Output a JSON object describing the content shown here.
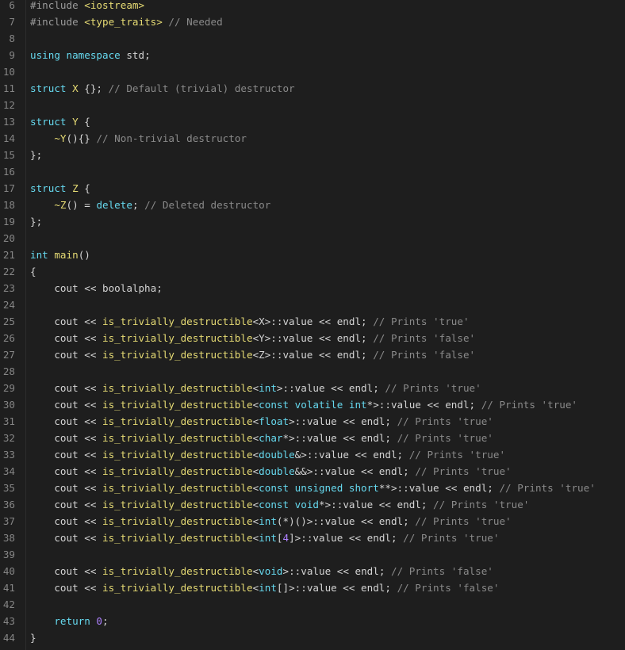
{
  "editor": {
    "lines": [
      {
        "n": "6",
        "tokens": [
          [
            "pp",
            "#include "
          ],
          [
            "inc",
            "<iostream>"
          ]
        ]
      },
      {
        "n": "7",
        "tokens": [
          [
            "pp",
            "#include "
          ],
          [
            "inc",
            "<type_traits>"
          ],
          [
            "cm",
            " // Needed"
          ]
        ]
      },
      {
        "n": "8",
        "tokens": []
      },
      {
        "n": "9",
        "tokens": [
          [
            "kw",
            "using namespace "
          ],
          [
            "tx",
            "std;"
          ]
        ]
      },
      {
        "n": "10",
        "tokens": []
      },
      {
        "n": "11",
        "tokens": [
          [
            "kw",
            "struct "
          ],
          [
            "nm",
            "X"
          ],
          [
            "tx",
            " {}; "
          ],
          [
            "cm",
            "// Default (trivial) destructor"
          ]
        ]
      },
      {
        "n": "12",
        "tokens": []
      },
      {
        "n": "13",
        "tokens": [
          [
            "kw",
            "struct "
          ],
          [
            "nm",
            "Y"
          ],
          [
            "tx",
            " {"
          ]
        ]
      },
      {
        "n": "14",
        "tokens": [
          [
            "tx",
            "    "
          ],
          [
            "fn",
            "~Y"
          ],
          [
            "tx",
            "(){} "
          ],
          [
            "cm",
            "// Non-trivial destructor"
          ]
        ]
      },
      {
        "n": "15",
        "tokens": [
          [
            "tx",
            "};"
          ]
        ]
      },
      {
        "n": "16",
        "tokens": []
      },
      {
        "n": "17",
        "tokens": [
          [
            "kw",
            "struct "
          ],
          [
            "nm",
            "Z"
          ],
          [
            "tx",
            " {"
          ]
        ]
      },
      {
        "n": "18",
        "tokens": [
          [
            "tx",
            "    "
          ],
          [
            "fn",
            "~Z"
          ],
          [
            "tx",
            "() = "
          ],
          [
            "kw",
            "delete"
          ],
          [
            "tx",
            "; "
          ],
          [
            "cm",
            "// Deleted destructor"
          ]
        ]
      },
      {
        "n": "19",
        "tokens": [
          [
            "tx",
            "};"
          ]
        ]
      },
      {
        "n": "20",
        "tokens": []
      },
      {
        "n": "21",
        "tokens": [
          [
            "ty",
            "int "
          ],
          [
            "fn",
            "main"
          ],
          [
            "tx",
            "()"
          ]
        ]
      },
      {
        "n": "22",
        "tokens": [
          [
            "tx",
            "{"
          ]
        ]
      },
      {
        "n": "23",
        "tokens": [
          [
            "tx",
            "    cout << boolalpha;"
          ]
        ]
      },
      {
        "n": "24",
        "tokens": []
      },
      {
        "n": "25",
        "tokens": [
          [
            "tx",
            "    cout << "
          ],
          [
            "fn",
            "is_trivially_destructible"
          ],
          [
            "tx",
            "<X>::value << endl; "
          ],
          [
            "cm",
            "// Prints 'true'"
          ]
        ]
      },
      {
        "n": "26",
        "tokens": [
          [
            "tx",
            "    cout << "
          ],
          [
            "fn",
            "is_trivially_destructible"
          ],
          [
            "tx",
            "<Y>::value << endl; "
          ],
          [
            "cm",
            "// Prints 'false'"
          ]
        ]
      },
      {
        "n": "27",
        "tokens": [
          [
            "tx",
            "    cout << "
          ],
          [
            "fn",
            "is_trivially_destructible"
          ],
          [
            "tx",
            "<Z>::value << endl; "
          ],
          [
            "cm",
            "// Prints 'false'"
          ]
        ]
      },
      {
        "n": "28",
        "tokens": []
      },
      {
        "n": "29",
        "tokens": [
          [
            "tx",
            "    cout << "
          ],
          [
            "fn",
            "is_trivially_destructible"
          ],
          [
            "tx",
            "<"
          ],
          [
            "ty",
            "int"
          ],
          [
            "tx",
            ">::value << endl; "
          ],
          [
            "cm",
            "// Prints 'true'"
          ]
        ]
      },
      {
        "n": "30",
        "tokens": [
          [
            "tx",
            "    cout << "
          ],
          [
            "fn",
            "is_trivially_destructible"
          ],
          [
            "tx",
            "<"
          ],
          [
            "ty",
            "const volatile int"
          ],
          [
            "tx",
            "*>::value << endl; "
          ],
          [
            "cm",
            "// Prints 'true'"
          ]
        ]
      },
      {
        "n": "31",
        "tokens": [
          [
            "tx",
            "    cout << "
          ],
          [
            "fn",
            "is_trivially_destructible"
          ],
          [
            "tx",
            "<"
          ],
          [
            "ty",
            "float"
          ],
          [
            "tx",
            ">::value << endl; "
          ],
          [
            "cm",
            "// Prints 'true'"
          ]
        ]
      },
      {
        "n": "32",
        "tokens": [
          [
            "tx",
            "    cout << "
          ],
          [
            "fn",
            "is_trivially_destructible"
          ],
          [
            "tx",
            "<"
          ],
          [
            "ty",
            "char"
          ],
          [
            "tx",
            "*>::value << endl; "
          ],
          [
            "cm",
            "// Prints 'true'"
          ]
        ]
      },
      {
        "n": "33",
        "tokens": [
          [
            "tx",
            "    cout << "
          ],
          [
            "fn",
            "is_trivially_destructible"
          ],
          [
            "tx",
            "<"
          ],
          [
            "ty",
            "double"
          ],
          [
            "tx",
            "&>::value << endl; "
          ],
          [
            "cm",
            "// Prints 'true'"
          ]
        ]
      },
      {
        "n": "34",
        "tokens": [
          [
            "tx",
            "    cout << "
          ],
          [
            "fn",
            "is_trivially_destructible"
          ],
          [
            "tx",
            "<"
          ],
          [
            "ty",
            "double"
          ],
          [
            "tx",
            "&&>::value << endl; "
          ],
          [
            "cm",
            "// Prints 'true'"
          ]
        ]
      },
      {
        "n": "35",
        "tokens": [
          [
            "tx",
            "    cout << "
          ],
          [
            "fn",
            "is_trivially_destructible"
          ],
          [
            "tx",
            "<"
          ],
          [
            "ty",
            "const unsigned short"
          ],
          [
            "tx",
            "**>::value << endl; "
          ],
          [
            "cm",
            "// Prints 'true'"
          ]
        ]
      },
      {
        "n": "36",
        "tokens": [
          [
            "tx",
            "    cout << "
          ],
          [
            "fn",
            "is_trivially_destructible"
          ],
          [
            "tx",
            "<"
          ],
          [
            "ty",
            "const void"
          ],
          [
            "tx",
            "*>::value << endl; "
          ],
          [
            "cm",
            "// Prints 'true'"
          ]
        ]
      },
      {
        "n": "37",
        "tokens": [
          [
            "tx",
            "    cout << "
          ],
          [
            "fn",
            "is_trivially_destructible"
          ],
          [
            "tx",
            "<"
          ],
          [
            "ty",
            "int"
          ],
          [
            "tx",
            "(*)()>::value << endl; "
          ],
          [
            "cm",
            "// Prints 'true'"
          ]
        ]
      },
      {
        "n": "38",
        "tokens": [
          [
            "tx",
            "    cout << "
          ],
          [
            "fn",
            "is_trivially_destructible"
          ],
          [
            "tx",
            "<"
          ],
          [
            "ty",
            "int"
          ],
          [
            "tx",
            "["
          ],
          [
            "num",
            "4"
          ],
          [
            "tx",
            "]>::value << endl; "
          ],
          [
            "cm",
            "// Prints 'true'"
          ]
        ]
      },
      {
        "n": "39",
        "tokens": []
      },
      {
        "n": "40",
        "tokens": [
          [
            "tx",
            "    cout << "
          ],
          [
            "fn",
            "is_trivially_destructible"
          ],
          [
            "tx",
            "<"
          ],
          [
            "ty",
            "void"
          ],
          [
            "tx",
            ">::value << endl; "
          ],
          [
            "cm",
            "// Prints 'false'"
          ]
        ]
      },
      {
        "n": "41",
        "tokens": [
          [
            "tx",
            "    cout << "
          ],
          [
            "fn",
            "is_trivially_destructible"
          ],
          [
            "tx",
            "<"
          ],
          [
            "ty",
            "int"
          ],
          [
            "tx",
            "[]>::value << endl; "
          ],
          [
            "cm",
            "// Prints 'false'"
          ]
        ]
      },
      {
        "n": "42",
        "tokens": []
      },
      {
        "n": "43",
        "tokens": [
          [
            "tx",
            "    "
          ],
          [
            "kw",
            "return "
          ],
          [
            "num",
            "0"
          ],
          [
            "tx",
            ";"
          ]
        ]
      },
      {
        "n": "44",
        "tokens": [
          [
            "tx",
            "}"
          ]
        ]
      }
    ]
  }
}
